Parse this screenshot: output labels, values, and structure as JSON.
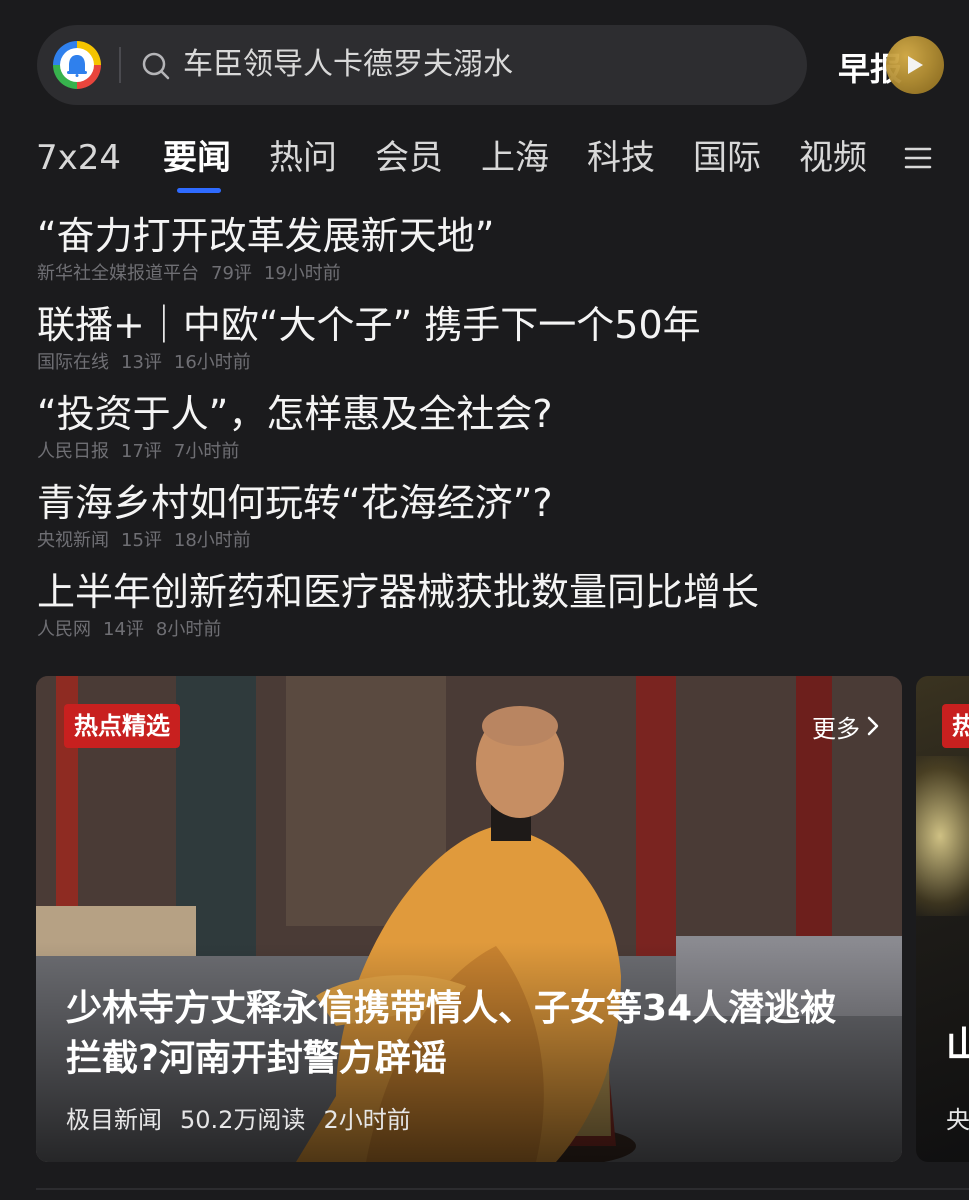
{
  "search": {
    "query": "车臣领导人卡德罗夫溺水",
    "morning_report_label": "早报"
  },
  "tabs": [
    {
      "label": "7x24"
    },
    {
      "label": "要闻"
    },
    {
      "label": "热问"
    },
    {
      "label": "会员"
    },
    {
      "label": "上海"
    },
    {
      "label": "科技"
    },
    {
      "label": "国际"
    },
    {
      "label": "视频"
    }
  ],
  "active_tab": "要闻",
  "news": [
    {
      "title": "“奋力打开改革发展新天地”",
      "source": "新华社全媒报道平台",
      "comments": "79评",
      "time": "19小时前"
    },
    {
      "title": "联播+｜中欧“大个子” 携手下一个50年",
      "source": "国际在线",
      "comments": "13评",
      "time": "16小时前"
    },
    {
      "title": "“投资于人”，怎样惠及全社会?",
      "source": "人民日报",
      "comments": "17评",
      "time": "7小时前"
    },
    {
      "title": "青海乡村如何玩转“花海经济”?",
      "source": "央视新闻",
      "comments": "15评",
      "time": "18小时前"
    },
    {
      "title": "上半年创新药和医疗器械获批数量同比增长",
      "source": "人民网",
      "comments": "14评",
      "time": "8小时前"
    }
  ],
  "hot_picks": {
    "badge": "热点精选",
    "more_label": "更多",
    "headline": "少林寺方丈释永信携带情人、子女等34人潜逃被拦截?河南开封警方辟谣",
    "source": "极目新闻",
    "reads": "50.2万阅读",
    "time": "2小时前"
  },
  "peek_card": {
    "badge": "热",
    "title": "山",
    "source": "央"
  },
  "colors": {
    "background": "#1b1b1d",
    "accent_blue": "#2f6bff",
    "badge_red": "#c8201f",
    "gold": "#c9a23a"
  },
  "icons": [
    "app-logo-icon",
    "search-icon",
    "play-icon",
    "menu-icon",
    "chevron-right-icon"
  ]
}
